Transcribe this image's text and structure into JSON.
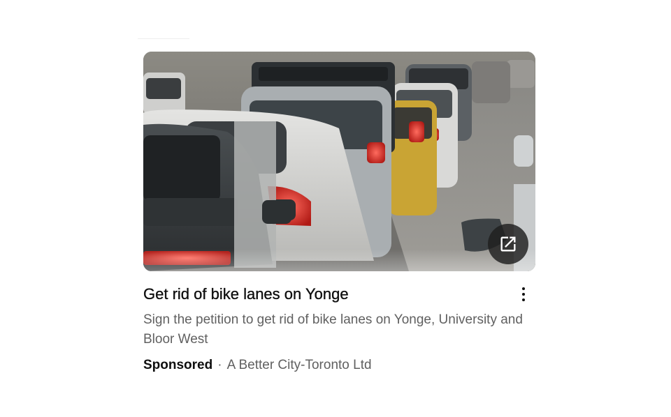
{
  "ad": {
    "image_alt": "Traffic jam of cars on a city street",
    "open_link_icon": "external-link-icon",
    "title": "Get rid of bike lanes on Yonge",
    "menu_icon": "more-vertical-icon",
    "description": "Sign the petition to get rid of bike lanes on Yonge, University and Bloor West",
    "sponsored_label": "Sponsored",
    "separator": "·",
    "advertiser": "A Better City-Toronto Ltd"
  },
  "colors": {
    "text_primary": "#0f0f0f",
    "text_secondary": "#606060",
    "background": "#ffffff",
    "overlay_button": "#1e1e1e"
  }
}
